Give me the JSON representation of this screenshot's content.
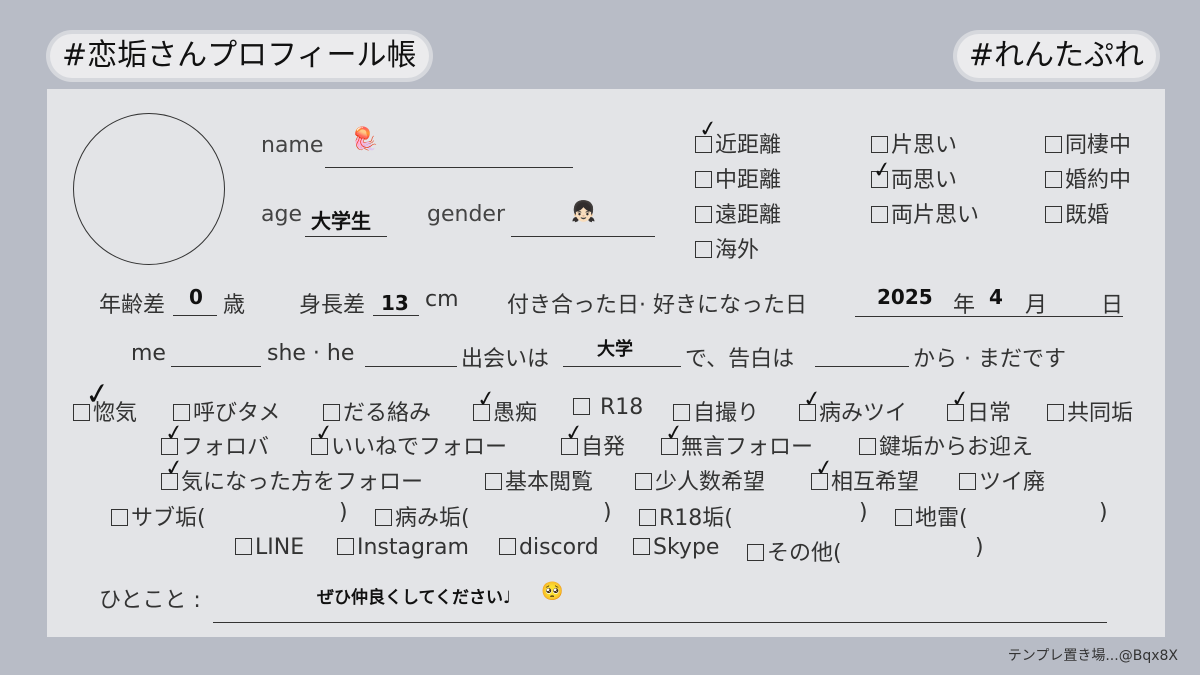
{
  "header": {
    "title_left": "#恋垢さんプロフィール帳",
    "title_right": "#れんたぷれ"
  },
  "profile": {
    "name_label": "name",
    "name_icon": "jellyfish-emoji",
    "name_emoji": "🪼",
    "age_label": "age",
    "age_value": "大学生",
    "gender_label": "gender",
    "gender_emoji": "👧🏻"
  },
  "distance": {
    "items": [
      {
        "label": "近距離",
        "checked": true
      },
      {
        "label": "片思い",
        "checked": false
      },
      {
        "label": "同棲中",
        "checked": false
      },
      {
        "label": "中距離",
        "checked": false
      },
      {
        "label": "両思い",
        "checked": true
      },
      {
        "label": "婚約中",
        "checked": false
      },
      {
        "label": "遠距離",
        "checked": false
      },
      {
        "label": "両片思い",
        "checked": false
      },
      {
        "label": "既婚",
        "checked": false
      },
      {
        "label": "海外",
        "checked": false
      }
    ]
  },
  "stats": {
    "age_diff_label": "年齢差",
    "age_diff_value": "0",
    "age_diff_unit": "歳",
    "height_diff_label": "身長差",
    "height_diff_value": "13",
    "height_diff_unit": "cm",
    "date_label": "付き合った日· 好きになった日",
    "year_value": "2025",
    "year_unit": "年",
    "month_value": "4",
    "month_unit": "月",
    "day_unit": "日"
  },
  "relation": {
    "me_label": "me",
    "partner_label": "she · he",
    "met_label": "出会いは",
    "met_value": "大学",
    "confess_label": "で、告白は",
    "confess_suffix": "から · まだです"
  },
  "tags": {
    "row1": [
      {
        "label": "惚気",
        "checked": true
      },
      {
        "label": "呼びタメ",
        "checked": false
      },
      {
        "label": "だる絡み",
        "checked": false
      },
      {
        "label": "愚痴",
        "checked": true
      },
      {
        "label": " R18",
        "checked": false
      },
      {
        "label": "自撮り",
        "checked": false
      },
      {
        "label": "病みツイ",
        "checked": true
      },
      {
        "label": "日常",
        "checked": true
      },
      {
        "label": "共同垢",
        "checked": false
      }
    ],
    "row2": [
      {
        "label": "フォロバ",
        "checked": true
      },
      {
        "label": "いいねでフォロー",
        "checked": true
      },
      {
        "label": "自発",
        "checked": true
      },
      {
        "label": "無言フォロー",
        "checked": true
      },
      {
        "label": "鍵垢からお迎え",
        "checked": false
      }
    ],
    "row3": [
      {
        "label": "気になった方をフォロー",
        "checked": true
      },
      {
        "label": "基本閲覧",
        "checked": false
      },
      {
        "label": "少人数希望",
        "checked": false
      },
      {
        "label": "相互希望",
        "checked": true
      },
      {
        "label": "ツイ廃",
        "checked": false
      }
    ],
    "row4": [
      {
        "label": "サブ垢(",
        "close": ")",
        "checked": false
      },
      {
        "label": "病み垢(",
        "close": ")",
        "checked": false
      },
      {
        "label": "R18垢(",
        "close": ")",
        "checked": false
      },
      {
        "label": "地雷(",
        "close": ")",
        "checked": false
      }
    ],
    "row5": [
      {
        "label": "LINE",
        "checked": false
      },
      {
        "label": "Instagram",
        "checked": false
      },
      {
        "label": "discord",
        "checked": false
      },
      {
        "label": "Skype",
        "checked": false
      },
      {
        "label": "その他(",
        "close": ")",
        "checked": false
      }
    ]
  },
  "comment": {
    "label": "ひとこと :",
    "value": "ぜひ仲良くしてください♩",
    "emoji": "🥺"
  },
  "footer": {
    "credit": "テンプレ置き場...@Bqx8X"
  },
  "colors": {
    "background": "#b8bcc6",
    "card": "#e3e4e7",
    "ink": "#222222"
  }
}
